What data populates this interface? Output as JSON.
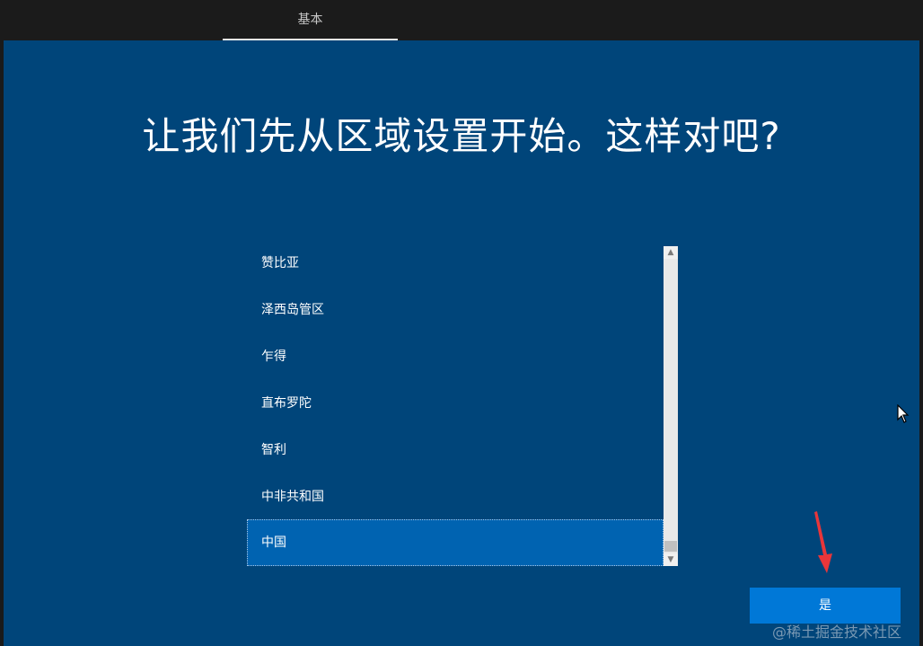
{
  "header": {
    "tab_label": "基本"
  },
  "main": {
    "heading": "让我们先从区域设置开始。这样对吧?",
    "region_list": {
      "items": [
        {
          "label": "赞比亚",
          "selected": false
        },
        {
          "label": "泽西岛管区",
          "selected": false
        },
        {
          "label": "乍得",
          "selected": false
        },
        {
          "label": "直布罗陀",
          "selected": false
        },
        {
          "label": "智利",
          "selected": false
        },
        {
          "label": "中非共和国",
          "selected": false
        },
        {
          "label": "中国",
          "selected": true
        }
      ],
      "scroll_position": 0.95
    },
    "yes_label": "是"
  },
  "watermark": "@稀土掘金技术社区",
  "icons": {
    "scroll_up": "chevron-up-icon",
    "scroll_down": "chevron-down-icon",
    "cursor": "mouse-pointer-icon",
    "annotation": "red-arrow-icon"
  },
  "colors": {
    "panel_bg": "#00457a",
    "selected_item": "#0063b1",
    "primary_button": "#0078d7",
    "annotation_arrow": "#e8363a"
  }
}
